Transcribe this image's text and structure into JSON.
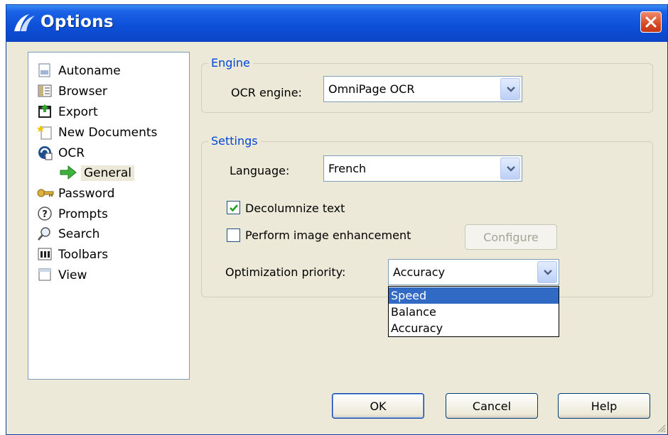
{
  "window": {
    "title": "Options",
    "close_icon": "close-icon"
  },
  "tree": {
    "items": [
      {
        "label": "Autoname",
        "icon": "autoname-icon"
      },
      {
        "label": "Browser",
        "icon": "browser-icon"
      },
      {
        "label": "Export",
        "icon": "export-icon"
      },
      {
        "label": "New Documents",
        "icon": "new-documents-icon"
      },
      {
        "label": "OCR",
        "icon": "ocr-icon"
      },
      {
        "label": "General",
        "icon": "green-arrow-icon",
        "selected": true
      },
      {
        "label": "Password",
        "icon": "key-icon"
      },
      {
        "label": "Prompts",
        "icon": "question-icon"
      },
      {
        "label": "Search",
        "icon": "magnifier-icon"
      },
      {
        "label": "Toolbars",
        "icon": "toolbars-icon"
      },
      {
        "label": "View",
        "icon": "view-icon"
      }
    ]
  },
  "engine": {
    "group_title": "Engine",
    "ocr_label": "OCR engine:",
    "ocr_value": "OmniPage OCR"
  },
  "settings": {
    "group_title": "Settings",
    "language_label": "Language:",
    "language_value": "French",
    "decolumnize_label": "Decolumnize text",
    "decolumnize_checked": true,
    "enhance_label": "Perform image enhancement",
    "enhance_checked": false,
    "configure_label": "Configure",
    "priority_label": "Optimization priority:",
    "priority_value": "Accuracy",
    "priority_options": [
      "Speed",
      "Balance",
      "Accuracy"
    ],
    "priority_highlighted": "Speed"
  },
  "buttons": {
    "ok": "OK",
    "cancel": "Cancel",
    "help": "Help"
  },
  "colors": {
    "titlebar": "#0d4fd8",
    "group_title": "#0046d5",
    "highlight": "#316ac5",
    "dialog_bg": "#ece9d8"
  }
}
